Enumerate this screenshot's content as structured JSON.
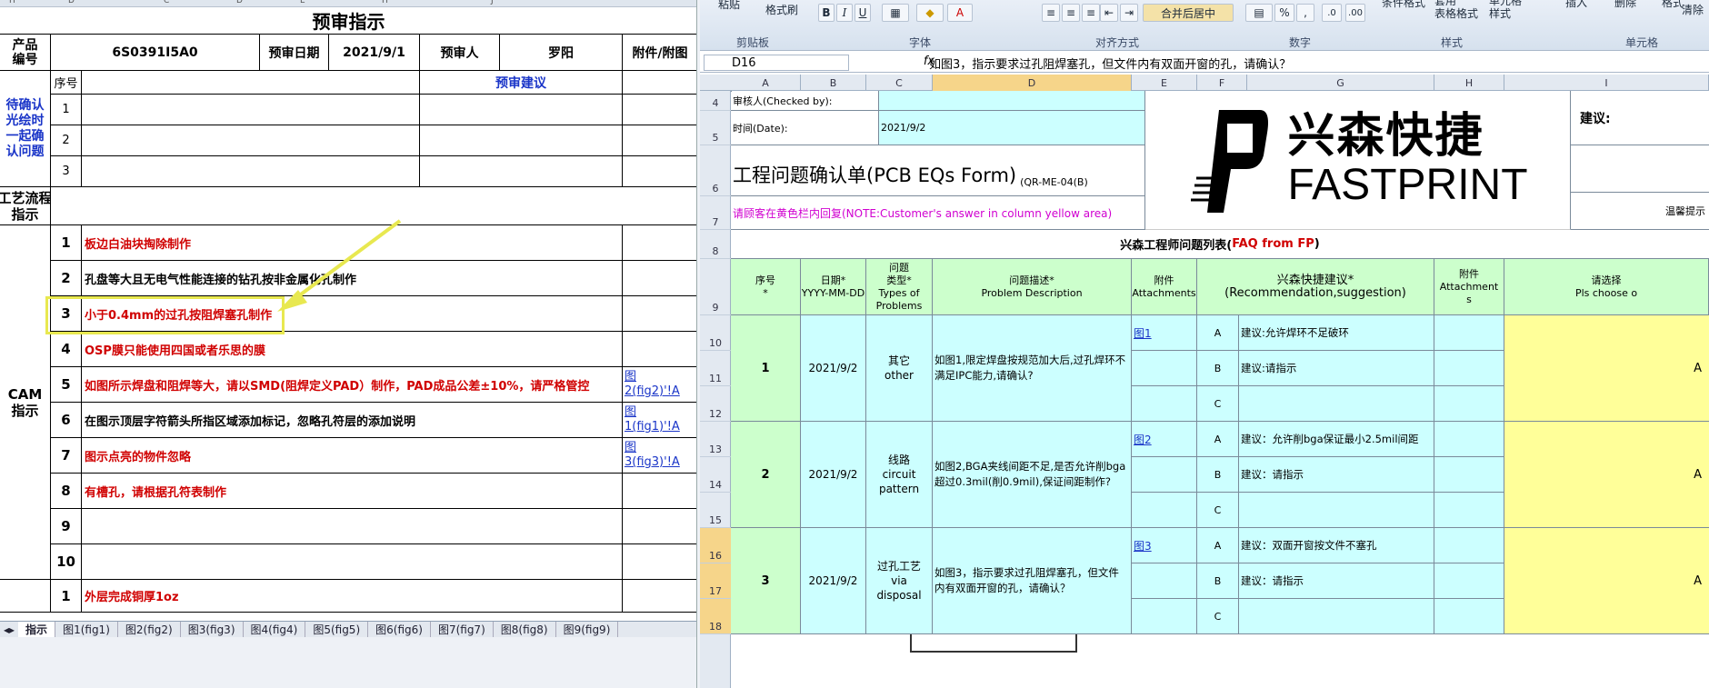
{
  "left": {
    "col_headers": [
      "H",
      "D",
      "C",
      "D",
      "E",
      "H",
      "J"
    ],
    "title": "预审指示",
    "product_label": "产品\n编号",
    "product_no": "6S0391I5A0",
    "date_label": "预审日期",
    "date_value": "2021/9/1",
    "reviewer_label": "预审人",
    "reviewer_value": "罗阳",
    "attach_label": "附件/附图",
    "pending_label": "待确认\n光绘时\n一起确\n认问题",
    "seq_label": "序号",
    "advice_label": "预审建议",
    "pending_rows": [
      "1",
      "2",
      "3"
    ],
    "process_label": "工艺流程\n指示",
    "cam_label": "CAM\n指示",
    "cam_rows": [
      {
        "no": "1",
        "text": "板边白油块掏除制作",
        "color": "red",
        "attach": ""
      },
      {
        "no": "2",
        "text": "孔盘等大且无电气性能连接的钻孔按非金属化孔制作",
        "color": "black",
        "attach": ""
      },
      {
        "no": "3",
        "text": "小于0.4mm的过孔按阻焊塞孔制作",
        "color": "red",
        "attach": ""
      },
      {
        "no": "4",
        "text": "OSP膜只能使用四国或者乐思的膜",
        "color": "red",
        "attach": ""
      },
      {
        "no": "5",
        "text": "如图所示焊盘和阻焊等大，请以SMD(阻焊定义PAD）制作，PAD成品公差±10%，请严格管控",
        "color": "red",
        "attach": "图\n2(fig2)'!A"
      },
      {
        "no": "6",
        "text": "在图示顶层字符箭头所指区域添加标记，忽略孔符层的添加说明",
        "color": "black",
        "attach": "图\n1(fig1)'!A"
      },
      {
        "no": "7",
        "text": "图示点亮的物件忽略",
        "color": "red",
        "attach": "图\n3(fig3)'!A"
      },
      {
        "no": "8",
        "text": "有槽孔，请根据孔符表制作",
        "color": "red",
        "attach": ""
      },
      {
        "no": "9",
        "text": "",
        "color": "black",
        "attach": ""
      },
      {
        "no": "10",
        "text": "",
        "color": "black",
        "attach": ""
      }
    ],
    "extra_row": {
      "no": "1",
      "text": "外层完成铜厚1oz"
    },
    "sheet_tabs": [
      "指示",
      "图1(fig1)",
      "图2(fig2)",
      "图3(fig3)",
      "图4(fig4)",
      "图5(fig5)",
      "图6(fig6)",
      "图7(fig7)",
      "图8(fig8)",
      "图9(fig9)"
    ]
  },
  "right": {
    "ribbon": {
      "paste": "粘贴",
      "format_painter": "格式刷",
      "clipboard": "剪贴板",
      "font": "字体",
      "align": "对齐方式",
      "merge_center": "合并后居中",
      "number": "数字",
      "cond_format": "条件格式",
      "table_format": "套用\n表格格式",
      "cell_style": "单元格\n样式",
      "styles": "样式",
      "insert": "插入",
      "delete": "删除",
      "format": "格式",
      "cells": "单元格",
      "clear": "清除",
      "percent": "%",
      "comma": ","
    },
    "name_box": "D16",
    "formula": "如图3，指示要求过孔阻焊塞孔，但文件内有双面开窗的孔，请确认？",
    "col_headers": [
      "A",
      "B",
      "C",
      "D",
      "E",
      "F",
      "G",
      "H",
      "I"
    ],
    "row_numbers": [
      "4",
      "5",
      "6",
      "7",
      "8",
      "9",
      "10",
      "11",
      "12",
      "13",
      "14",
      "15",
      "16",
      "17",
      "18"
    ],
    "checked_by": "审核人(Checked by):",
    "time_label": "时间(Date):",
    "time_value": "2021/9/2",
    "form_title": "工程问题确认单(PCB EQs Form)",
    "form_code": "(QR-ME-04(B)",
    "note": "请顾客在黄色栏内回复(NOTE:Customer's answer in column yellow area)",
    "logo_cn": "兴森快捷",
    "logo_en": "FASTPRINT",
    "suggest_label": "建议:",
    "warm_tip": "温馨提示",
    "list_title": "兴森工程师问题列表(",
    "list_title_en": "FAQ from FP",
    "list_title_end": ")",
    "headers": {
      "seq": "序号\n*",
      "date": "日期*\nYYYY-MM-DD",
      "type": "问题\n类型*\nTypes of\nProblems",
      "desc": "问题描述*\nProblem Description",
      "attach": "附件\nAttachments",
      "rec": "兴森快捷建议*\n(Recommendation,suggestion)",
      "attach2": "附件\nAttachment\ns",
      "choose": "请选择\nPls choose o"
    },
    "questions": [
      {
        "seq": "1",
        "date": "2021/9/2",
        "type": "其它\nother",
        "desc": "如图1,限定焊盘按规范加大后,过孔焊环不满足IPC能力,请确认?",
        "fig": "图1",
        "opts": [
          {
            "k": "A",
            "v": "建议:允许焊环不足破环"
          },
          {
            "k": "B",
            "v": "建议:请指示"
          },
          {
            "k": "C",
            "v": ""
          }
        ],
        "ans": "A"
      },
      {
        "seq": "2",
        "date": "2021/9/2",
        "type": "线路\ncircuit\npattern",
        "desc": "如图2,BGA夹线间距不足,是否允许削bga超过0.3mil(削0.9mil),保证间距制作?",
        "fig": "图2",
        "opts": [
          {
            "k": "A",
            "v": "建议：允许削bga保证最小2.5mil间距"
          },
          {
            "k": "B",
            "v": "建议：请指示"
          },
          {
            "k": "C",
            "v": ""
          }
        ],
        "ans": "A"
      },
      {
        "seq": "3",
        "date": "2021/9/2",
        "type": "过孔工艺\nvia\ndisposal",
        "desc": "如图3，指示要求过孔阻焊塞孔，但文件内有双面开窗的孔，请确认？",
        "fig": "图3",
        "opts": [
          {
            "k": "A",
            "v": "建议：双面开窗按文件不塞孔"
          },
          {
            "k": "B",
            "v": "建议：请指示"
          },
          {
            "k": "C",
            "v": ""
          }
        ],
        "ans": "A"
      }
    ],
    "accent_cyan": "#ccffff",
    "accent_green": "#ccffcc",
    "accent_yellow": "#ffff99"
  }
}
